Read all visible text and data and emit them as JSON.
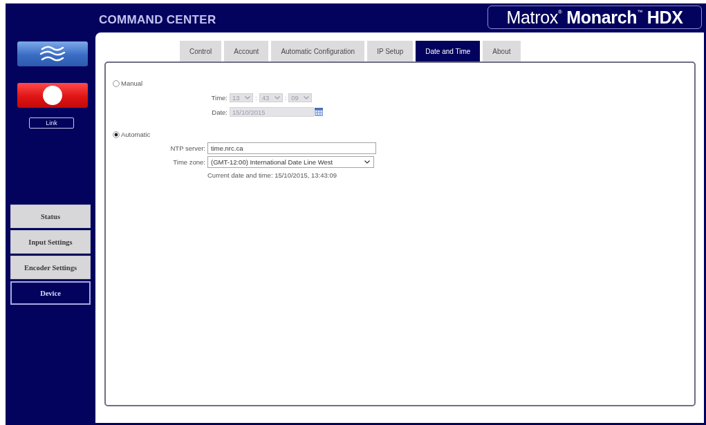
{
  "header": {
    "title": "COMMAND CENTER",
    "logo": "Matrox$^{®}$ **Monarch**$^{™}$ **HDX**"
  },
  "sidebar": {
    "link_button": "Link",
    "nav": [
      {
        "label": "Status",
        "selected": false
      },
      {
        "label": "Input Settings",
        "selected": false
      },
      {
        "label": "Encoder Settings",
        "selected": false
      },
      {
        "label": "Device",
        "selected": true
      }
    ]
  },
  "tabs": [
    {
      "label": "Control",
      "selected": false
    },
    {
      "label": "Account",
      "selected": false
    },
    {
      "label": "Automatic Configuration",
      "selected": false
    },
    {
      "label": "IP Setup",
      "selected": false
    },
    {
      "label": "Date and Time",
      "selected": true
    },
    {
      "label": "About",
      "selected": false
    }
  ],
  "form": {
    "manual": {
      "label": "Manual",
      "selected": false,
      "disabled": true,
      "time_label": "Time:",
      "time": [
        "13",
        "43",
        "09"
      ],
      "separators": [
        ":",
        ":"
      ],
      "date_label": "Date:",
      "date": "15/10/2015"
    },
    "automatic": {
      "label": "Automatic",
      "selected": true,
      "ntp_label": "NTP server:",
      "ntp_server": "time.nrc.ca",
      "timezone_label": "Time zone:",
      "timezone": "(GMT-12:00) International Date Line West",
      "current": "Current date and time: 15/10/2015, 13:43:09"
    }
  }
}
